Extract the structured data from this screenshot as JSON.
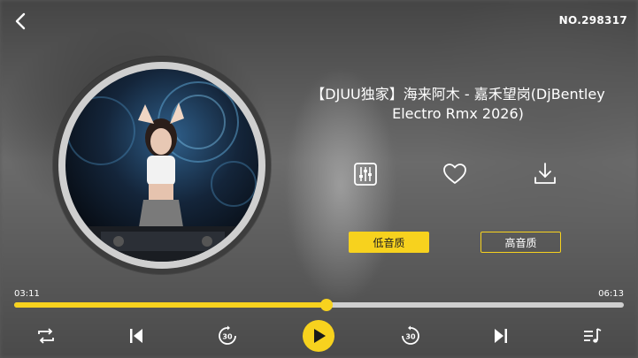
{
  "header": {
    "back_icon": "chevron-left-icon",
    "track_number": "NO.298317"
  },
  "song": {
    "title": "【DJUU独家】海来阿木 - 嘉禾望岗(DjBentley Electro Rmx 2026)"
  },
  "actions": [
    {
      "name": "equalizer",
      "icon": "equalizer-icon"
    },
    {
      "name": "favorite",
      "icon": "heart-icon"
    },
    {
      "name": "download",
      "icon": "download-icon"
    }
  ],
  "quality": {
    "low_label": "低音质",
    "high_label": "高音质",
    "selected": "low"
  },
  "playback": {
    "elapsed": "03:11",
    "duration": "06:13",
    "progress_fraction": 0.513
  },
  "controls": {
    "repeat_icon": "repeat-icon",
    "previous_icon": "skip-previous-icon",
    "rewind_label": "30",
    "play_icon": "play-icon",
    "forward_label": "30",
    "next_icon": "skip-next-icon",
    "playlist_icon": "playlist-icon"
  },
  "colors": {
    "accent": "#f7d21e",
    "track_bg": "#cfcfcf"
  }
}
